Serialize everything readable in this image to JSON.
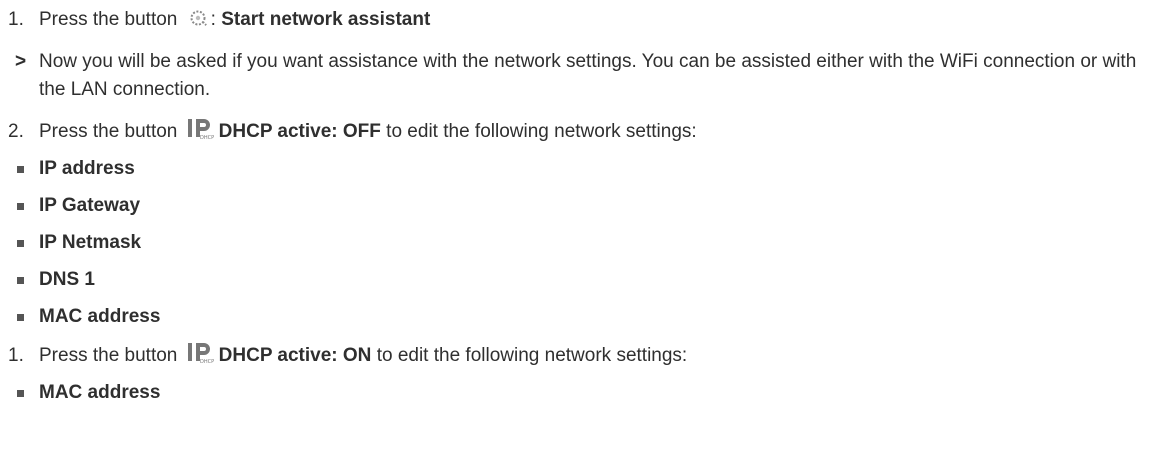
{
  "steps": [
    {
      "marker": "1.",
      "before": "Press the button ",
      "icon": "network-assistant-gear-icon",
      "colon": ":",
      "bold": "Start network assistant"
    }
  ],
  "result": {
    "marker": ">",
    "text": "Now you will be asked if you want assistance with the network settings. You can be assisted either with the WiFi connection or with the LAN connection."
  },
  "step2": {
    "marker": "2.",
    "before": "Press the button ",
    "icon": "ip-dhcp-icon",
    "bold": "DHCP active: OFF",
    "after": " to edit the following network settings:",
    "items": [
      "IP address",
      "IP Gateway",
      "IP Netmask",
      "DNS 1",
      "MAC address"
    ]
  },
  "step3": {
    "marker": "1.",
    "before": "Press the button ",
    "icon": "ip-dhcp-icon",
    "bold": "DHCP active: ON",
    "after": " to edit the following network settings:",
    "items": [
      "MAC address"
    ]
  },
  "colors": {
    "text": "#2f2f2f",
    "icon": "#777777",
    "bullet": "#555555"
  }
}
